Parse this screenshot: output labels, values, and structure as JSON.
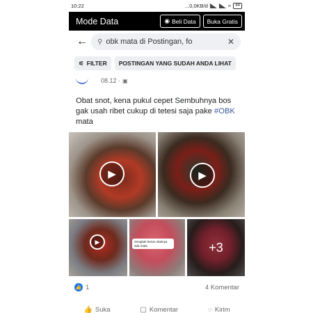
{
  "status_bar": {
    "time": "10:22",
    "network_speed": "...0,0KB/d",
    "battery": "44"
  },
  "mode_bar": {
    "title": "Mode Data",
    "buy_button": "Beli Data",
    "free_button": "Buka Gratis",
    "buy_icon": "data-icon"
  },
  "search": {
    "query": "obk mata di Postingan, fo",
    "back_icon": "back-arrow-icon",
    "search_icon": "search-icon",
    "clear_icon": "close-icon"
  },
  "filters": {
    "filter_label": "FILTER",
    "seen_posts_label": "POSTINGAN YANG SUDAH ANDA LIHAT"
  },
  "post": {
    "time": "08.12 ·",
    "privacy_icon": "audience-icon",
    "text_before": "Obat snot, kena pukul cepet Sembuhnya bos gak usah ribet cukup di tetesi saja pake ",
    "hashtag": "#OBK",
    "text_after": " mata",
    "media": {
      "caption_text": "Sengkak benar obatnya ada mata",
      "more_count": "+3"
    },
    "reaction_count": "1",
    "comment_count": "4 Komentar",
    "actions": {
      "like": "Suka",
      "comment": "Komentar",
      "share": "Kirim"
    }
  },
  "colors": {
    "accent": "#1877f2",
    "hashtag": "#385898",
    "mode_bar_bg": "#000000"
  }
}
